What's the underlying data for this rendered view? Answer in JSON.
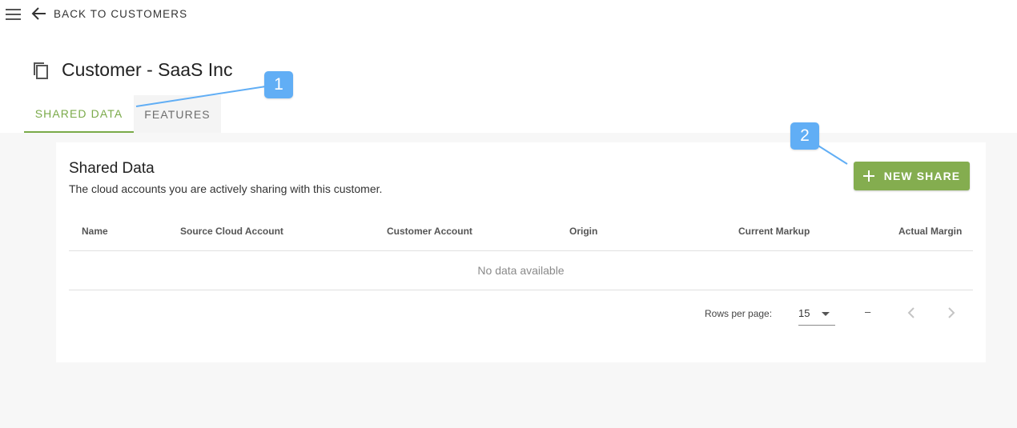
{
  "header": {
    "back_label": "BACK TO CUSTOMERS"
  },
  "page": {
    "title": "Customer - SaaS Inc"
  },
  "tabs": [
    {
      "label": "SHARED DATA",
      "active": true
    },
    {
      "label": "FEATURES",
      "active": false
    }
  ],
  "card": {
    "title": "Shared Data",
    "subtitle": "The cloud accounts you are actively sharing with this customer.",
    "new_share_label": "NEW SHARE"
  },
  "table": {
    "columns": [
      "Name",
      "Source Cloud Account",
      "Customer Account",
      "Origin",
      "Current Markup",
      "Actual Margin"
    ],
    "rows": [],
    "empty_text": "No data available"
  },
  "pagination": {
    "rows_per_page_label": "Rows per page:",
    "rows_per_page": "15",
    "range": "–"
  },
  "callouts": [
    {
      "number": "1"
    },
    {
      "number": "2"
    }
  ],
  "colors": {
    "accent": "#84ad4f",
    "tab_active": "#7aaa49",
    "callout": "#61aef5"
  },
  "icons": {
    "menu": "menu-icon",
    "back": "arrow-left-icon",
    "title": "copy-icon",
    "add": "plus-icon",
    "prev": "chevron-left-icon",
    "next": "chevron-right-icon",
    "rpp_dropdown": "caret-down-icon"
  }
}
